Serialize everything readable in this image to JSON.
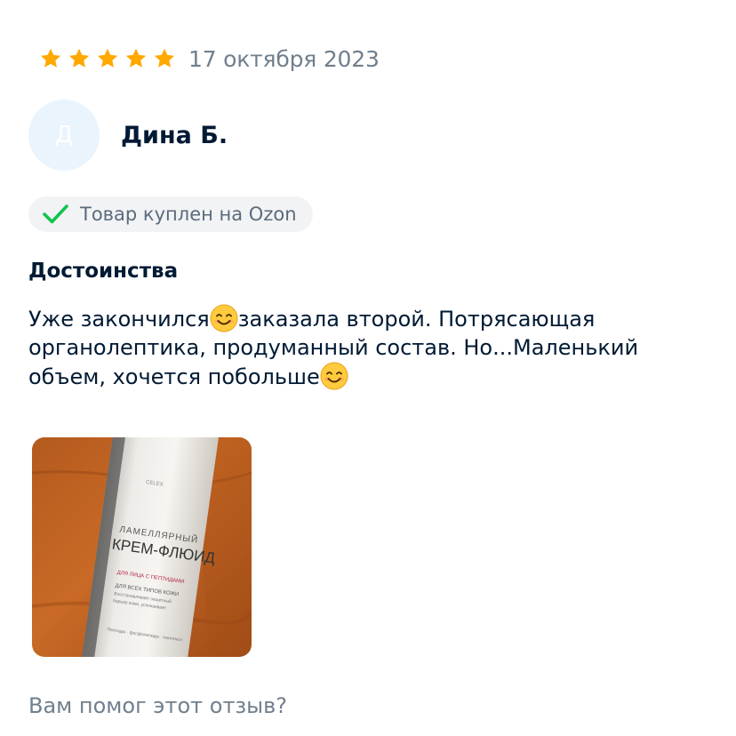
{
  "review": {
    "rating": 5,
    "rating_max": 5,
    "date": "17 октября 2023",
    "author": {
      "initial": "Д",
      "name": "Дина Б."
    },
    "purchase_badge": "Товар куплен на Ozon",
    "section_title": "Достоинства",
    "text": {
      "part1": "Уже закончился",
      "part2": "заказала второй. Потрясающая органолептика, продуманный состав. Но...Маленький объем, хочется побольше",
      "emoji": "smiling-face-emoji"
    },
    "photo": {
      "icon": "product-photo",
      "brand": "CELEX",
      "line1": "ЛАМЕЛЛЯРНЫЙ",
      "line2": "КРЕМ-ФЛЮИД",
      "line3": "ДЛЯ ЛИЦА С ПЕПТИДАМИ",
      "line4": "ДЛЯ ВСЕХ ТИПОВ КОЖИ",
      "line5": "Восстанавливает защитный",
      "line6": "барьер кожи, успокаивает",
      "line7": "Пептиды · фосфолипиды · пантенол"
    },
    "helpful_question": "Вам помог этот отзыв?"
  },
  "colors": {
    "star": "#ffa800",
    "check": "#10c44c",
    "text_primary": "#001a34",
    "text_secondary": "#707f8d",
    "badge_bg": "#f2f3f5",
    "avatar_bg": "#eaf4fd"
  }
}
